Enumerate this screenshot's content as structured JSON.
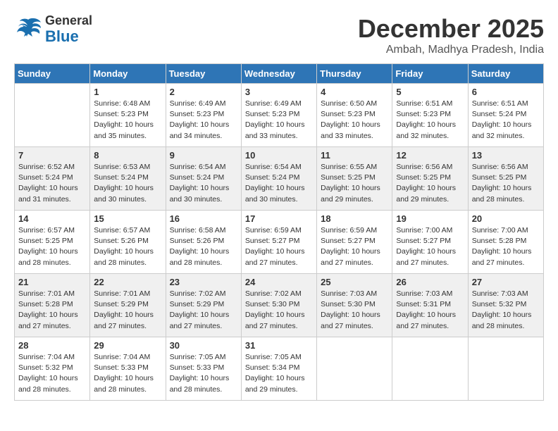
{
  "header": {
    "logo_general": "General",
    "logo_blue": "Blue",
    "month": "December 2025",
    "location": "Ambah, Madhya Pradesh, India"
  },
  "days_of_week": [
    "Sunday",
    "Monday",
    "Tuesday",
    "Wednesday",
    "Thursday",
    "Friday",
    "Saturday"
  ],
  "weeks": [
    [
      {
        "day": "",
        "info": ""
      },
      {
        "day": "1",
        "info": "Sunrise: 6:48 AM\nSunset: 5:23 PM\nDaylight: 10 hours\nand 35 minutes."
      },
      {
        "day": "2",
        "info": "Sunrise: 6:49 AM\nSunset: 5:23 PM\nDaylight: 10 hours\nand 34 minutes."
      },
      {
        "day": "3",
        "info": "Sunrise: 6:49 AM\nSunset: 5:23 PM\nDaylight: 10 hours\nand 33 minutes."
      },
      {
        "day": "4",
        "info": "Sunrise: 6:50 AM\nSunset: 5:23 PM\nDaylight: 10 hours\nand 33 minutes."
      },
      {
        "day": "5",
        "info": "Sunrise: 6:51 AM\nSunset: 5:23 PM\nDaylight: 10 hours\nand 32 minutes."
      },
      {
        "day": "6",
        "info": "Sunrise: 6:51 AM\nSunset: 5:24 PM\nDaylight: 10 hours\nand 32 minutes."
      }
    ],
    [
      {
        "day": "7",
        "info": "Sunrise: 6:52 AM\nSunset: 5:24 PM\nDaylight: 10 hours\nand 31 minutes."
      },
      {
        "day": "8",
        "info": "Sunrise: 6:53 AM\nSunset: 5:24 PM\nDaylight: 10 hours\nand 30 minutes."
      },
      {
        "day": "9",
        "info": "Sunrise: 6:54 AM\nSunset: 5:24 PM\nDaylight: 10 hours\nand 30 minutes."
      },
      {
        "day": "10",
        "info": "Sunrise: 6:54 AM\nSunset: 5:24 PM\nDaylight: 10 hours\nand 30 minutes."
      },
      {
        "day": "11",
        "info": "Sunrise: 6:55 AM\nSunset: 5:25 PM\nDaylight: 10 hours\nand 29 minutes."
      },
      {
        "day": "12",
        "info": "Sunrise: 6:56 AM\nSunset: 5:25 PM\nDaylight: 10 hours\nand 29 minutes."
      },
      {
        "day": "13",
        "info": "Sunrise: 6:56 AM\nSunset: 5:25 PM\nDaylight: 10 hours\nand 28 minutes."
      }
    ],
    [
      {
        "day": "14",
        "info": "Sunrise: 6:57 AM\nSunset: 5:25 PM\nDaylight: 10 hours\nand 28 minutes."
      },
      {
        "day": "15",
        "info": "Sunrise: 6:57 AM\nSunset: 5:26 PM\nDaylight: 10 hours\nand 28 minutes."
      },
      {
        "day": "16",
        "info": "Sunrise: 6:58 AM\nSunset: 5:26 PM\nDaylight: 10 hours\nand 28 minutes."
      },
      {
        "day": "17",
        "info": "Sunrise: 6:59 AM\nSunset: 5:27 PM\nDaylight: 10 hours\nand 27 minutes."
      },
      {
        "day": "18",
        "info": "Sunrise: 6:59 AM\nSunset: 5:27 PM\nDaylight: 10 hours\nand 27 minutes."
      },
      {
        "day": "19",
        "info": "Sunrise: 7:00 AM\nSunset: 5:27 PM\nDaylight: 10 hours\nand 27 minutes."
      },
      {
        "day": "20",
        "info": "Sunrise: 7:00 AM\nSunset: 5:28 PM\nDaylight: 10 hours\nand 27 minutes."
      }
    ],
    [
      {
        "day": "21",
        "info": "Sunrise: 7:01 AM\nSunset: 5:28 PM\nDaylight: 10 hours\nand 27 minutes."
      },
      {
        "day": "22",
        "info": "Sunrise: 7:01 AM\nSunset: 5:29 PM\nDaylight: 10 hours\nand 27 minutes."
      },
      {
        "day": "23",
        "info": "Sunrise: 7:02 AM\nSunset: 5:29 PM\nDaylight: 10 hours\nand 27 minutes."
      },
      {
        "day": "24",
        "info": "Sunrise: 7:02 AM\nSunset: 5:30 PM\nDaylight: 10 hours\nand 27 minutes."
      },
      {
        "day": "25",
        "info": "Sunrise: 7:03 AM\nSunset: 5:30 PM\nDaylight: 10 hours\nand 27 minutes."
      },
      {
        "day": "26",
        "info": "Sunrise: 7:03 AM\nSunset: 5:31 PM\nDaylight: 10 hours\nand 27 minutes."
      },
      {
        "day": "27",
        "info": "Sunrise: 7:03 AM\nSunset: 5:32 PM\nDaylight: 10 hours\nand 28 minutes."
      }
    ],
    [
      {
        "day": "28",
        "info": "Sunrise: 7:04 AM\nSunset: 5:32 PM\nDaylight: 10 hours\nand 28 minutes."
      },
      {
        "day": "29",
        "info": "Sunrise: 7:04 AM\nSunset: 5:33 PM\nDaylight: 10 hours\nand 28 minutes."
      },
      {
        "day": "30",
        "info": "Sunrise: 7:05 AM\nSunset: 5:33 PM\nDaylight: 10 hours\nand 28 minutes."
      },
      {
        "day": "31",
        "info": "Sunrise: 7:05 AM\nSunset: 5:34 PM\nDaylight: 10 hours\nand 29 minutes."
      },
      {
        "day": "",
        "info": ""
      },
      {
        "day": "",
        "info": ""
      },
      {
        "day": "",
        "info": ""
      }
    ]
  ]
}
